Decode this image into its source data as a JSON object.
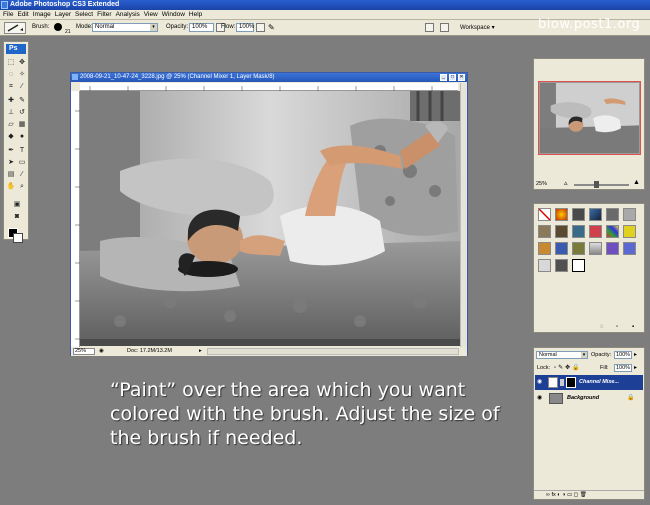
{
  "window": {
    "title": "Adobe Photoshop CS3 Extended"
  },
  "menu": [
    "File",
    "Edit",
    "Image",
    "Layer",
    "Select",
    "Filter",
    "Analysis",
    "View",
    "Window",
    "Help"
  ],
  "options": {
    "brush_label": "Brush:",
    "brush_size": "21",
    "mode_label": "Mode:",
    "mode_value": "Normal",
    "opacity_label": "Opacity:",
    "opacity_value": "100%",
    "flow_label": "Flow:",
    "flow_value": "100%",
    "workspace_label": "Workspace ▾"
  },
  "watermark": "biow.post1.org",
  "toolbox": {
    "logo": "Ps"
  },
  "document": {
    "title": "2008-09-21_10-47-24_3228.jpg @ 25% (Channel Mixer 1, Layer Mask/8)",
    "zoom": "25%",
    "doc_size": "Doc: 17.2M/13.2M"
  },
  "caption": "“Paint” over the area which you want colored with the brush. Adjust the size of the brush if needed.",
  "navigator": {
    "zoom": "25%"
  },
  "layers": {
    "blend_mode": "Normal",
    "opacity_label": "Opacity:",
    "opacity_value": "100%",
    "lock_label": "Lock:",
    "fill_label": "Fill:",
    "fill_value": "100%",
    "items": [
      {
        "name": "Channel Mixe...",
        "selected": true
      },
      {
        "name": "Background",
        "selected": false
      }
    ],
    "bottom_icons": "∞  fx  ◐  ◑  ▭  ◻  🗑"
  }
}
